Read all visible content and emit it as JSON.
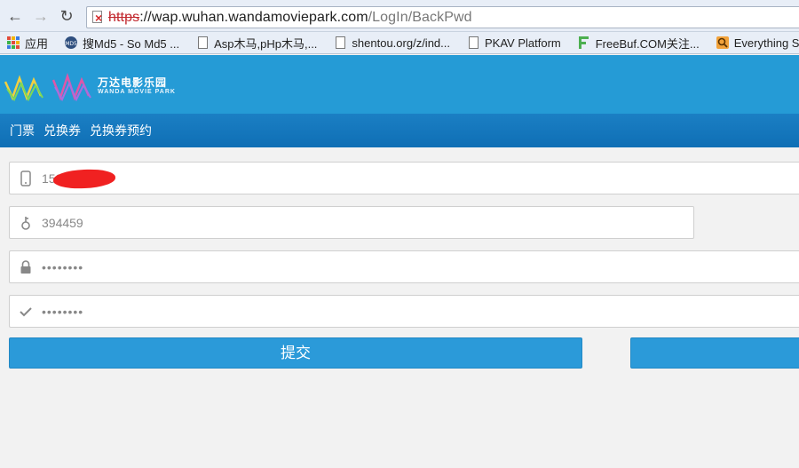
{
  "browser": {
    "url_scheme": "https",
    "url_host": "://wap.wuhan.wandamoviepark.com",
    "url_path": "/LogIn/BackPwd",
    "bookmarks": [
      {
        "label": "应用",
        "icon": "apps-grid-icon"
      },
      {
        "label": "搜Md5 - So Md5 ...",
        "icon": "md5-icon"
      },
      {
        "label": "Asp木马,pHp木马,...",
        "icon": "page-icon"
      },
      {
        "label": "shentou.org/z/ind...",
        "icon": "page-icon"
      },
      {
        "label": "PKAV Platform",
        "icon": "page-icon"
      },
      {
        "label": "FreeBuf.COM关注...",
        "icon": "freebuf-icon"
      },
      {
        "label": "Everything Search",
        "icon": "search-tool-icon"
      }
    ]
  },
  "site": {
    "logo_cn": "万达电影乐园",
    "logo_en": "WANDA MOVIE PARK",
    "nav": [
      "门票",
      "兑换券",
      "兑换券预约"
    ]
  },
  "form": {
    "phone_value": "152          1",
    "code_value": "394459",
    "password_value": "••••••••",
    "confirm_value": "••••••••",
    "submit_label": "提交"
  },
  "colors": {
    "header_blue": "#259bd6",
    "nav_blue": "#0f6fb5",
    "button_blue": "#2b9ad9",
    "redaction_red": "#f02121"
  }
}
